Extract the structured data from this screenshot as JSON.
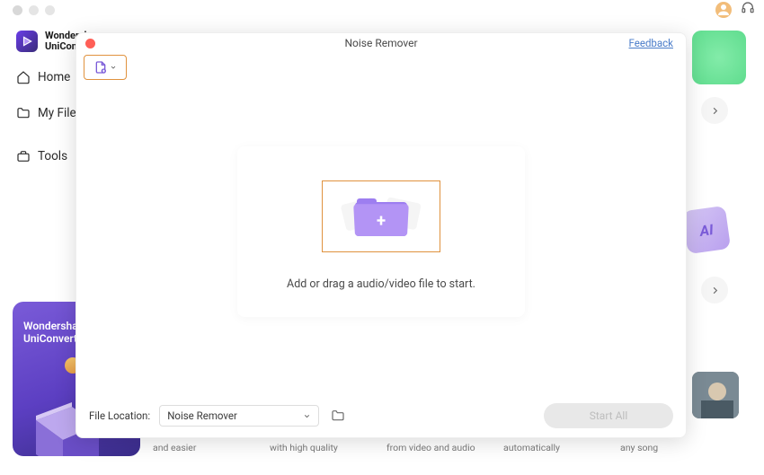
{
  "brand": {
    "line1": "Wondersh",
    "line2": "UniConve"
  },
  "topbar": {
    "avatar": "user-avatar",
    "support": "support-headset"
  },
  "sidebar": {
    "items": [
      {
        "label": "Home",
        "icon": "home-icon",
        "active": true
      },
      {
        "label": "My File",
        "icon": "folder-icon",
        "active": false
      },
      {
        "label": "Tools",
        "icon": "toolbox-icon",
        "active": false
      }
    ]
  },
  "promo": {
    "line1": "Wondershare",
    "line2": "UniConverter"
  },
  "background_tiles": {
    "ai_label": "AI",
    "captions": [
      "and easier",
      "with high quality",
      "from video and audio",
      "automatically",
      "any song"
    ]
  },
  "modal": {
    "title": "Noise Remover",
    "feedback": "Feedback",
    "dropzone_text": "Add or drag a audio/video file to start.",
    "file_location_label": "File Location:",
    "file_location_value": "Noise Remover",
    "start_button": "Start All"
  }
}
